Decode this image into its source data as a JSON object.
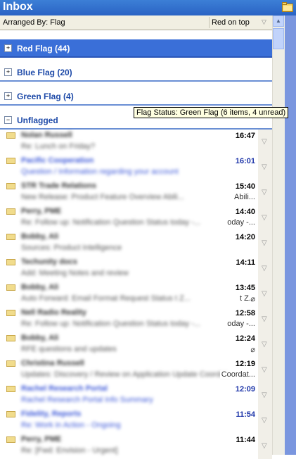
{
  "window": {
    "title": "Inbox"
  },
  "arrange": {
    "label": "Arranged By: Flag",
    "sort": "Red on top",
    "sort_flag_glyph": "▽"
  },
  "groups": [
    {
      "label": "Red Flag (44)",
      "toggle": "+"
    },
    {
      "label": "Blue Flag (20)",
      "toggle": "+"
    },
    {
      "label": "Green Flag (4)",
      "toggle": "+"
    },
    {
      "label": "Unflagged",
      "toggle": "−"
    }
  ],
  "tooltip": "Flag Status: Green Flag (6 items, 4 unread)",
  "messages": [
    {
      "sender": "Nolan Russell",
      "subject": "Re: Lunch on Friday?",
      "subject_tail": "",
      "time": "16:47",
      "unread": false,
      "attachment": false
    },
    {
      "sender": "Pacific Cooperation",
      "subject": "Question / Information regarding your account",
      "subject_tail": "",
      "time": "16:01",
      "unread": true,
      "attachment": false
    },
    {
      "sender": "STR Trade Relations",
      "subject": "New Release: Product Feature Overview Abili...",
      "subject_tail": "Abili...",
      "time": "15:40",
      "unread": false,
      "attachment": false
    },
    {
      "sender": "Perry, PME",
      "subject": "Re: Follow up: Notification Question Status today -...",
      "subject_tail": "oday -...",
      "time": "14:40",
      "unread": false,
      "attachment": false
    },
    {
      "sender": "Bobby, Ali",
      "subject": "Sources: Product Intelligence",
      "subject_tail": "",
      "time": "14:20",
      "unread": false,
      "attachment": false
    },
    {
      "sender": "Techunity docs",
      "subject": "Add: Meeting Notes and review",
      "subject_tail": "",
      "time": "14:11",
      "unread": false,
      "attachment": false
    },
    {
      "sender": "Bobby, Ali",
      "subject": "Auto Forward: Email Format Request Status t Z...",
      "subject_tail": "t Z...",
      "time": "13:45",
      "unread": false,
      "attachment": true
    },
    {
      "sender": "Nell Radio Reality",
      "subject": "Re: Follow up: Notification Question Status today -...",
      "subject_tail": "oday -...",
      "time": "12:58",
      "unread": false,
      "attachment": false
    },
    {
      "sender": "Bobby, Ali",
      "subject": "RFE questions and updates",
      "subject_tail": "",
      "time": "12:24",
      "unread": false,
      "attachment": true
    },
    {
      "sender": "Christina Russell",
      "subject": "Updates: Discovery / Review on Application Update Coordat...",
      "subject_tail": "Coordat...",
      "time": "12:19",
      "unread": false,
      "attachment": false
    },
    {
      "sender": "Rachel Research Portal",
      "subject": "Rachel Research Portal Info Summary",
      "subject_tail": "",
      "time": "12:09",
      "unread": true,
      "attachment": false
    },
    {
      "sender": "Fidelity, Reports",
      "subject": "Re: Work in Action - Ongoing",
      "subject_tail": "",
      "time": "11:54",
      "unread": true,
      "attachment": false
    },
    {
      "sender": "Perry, PME",
      "subject": "Re: [Fwd: Envision - Urgent]",
      "subject_tail": "",
      "time": "11:44",
      "unread": false,
      "attachment": false
    }
  ]
}
